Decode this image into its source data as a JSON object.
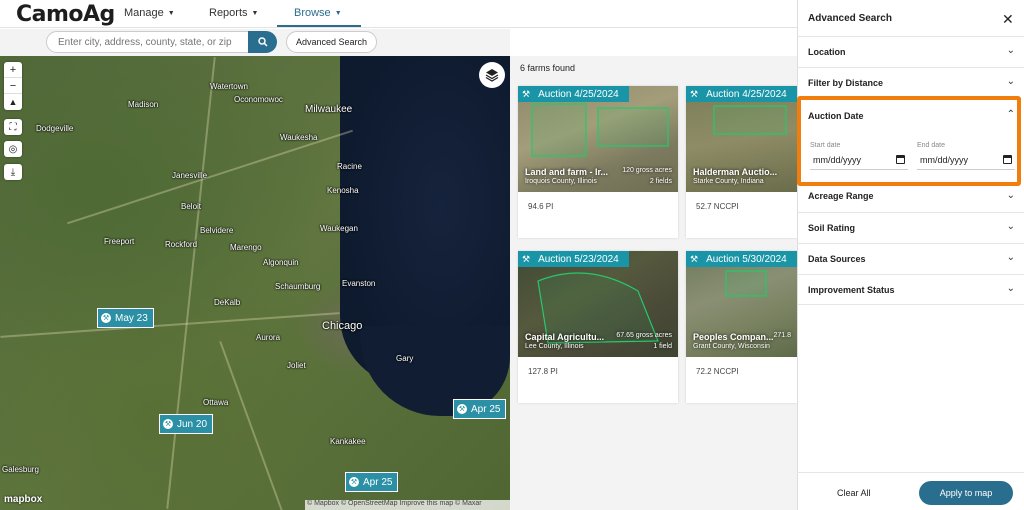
{
  "header": {
    "logo": "CamoAg",
    "nav": [
      {
        "label": "Manage"
      },
      {
        "label": "Reports"
      },
      {
        "label": "Browse"
      }
    ]
  },
  "search": {
    "placeholder": "Enter city, address, county, state, or zip",
    "advanced_label": "Advanced Search"
  },
  "map": {
    "cities": [
      "Madison",
      "Milwaukee",
      "Waukesha",
      "Janesville",
      "Racine",
      "Kenosha",
      "Beloit",
      "Waukegan",
      "Freeport",
      "Rockford",
      "Marengo",
      "Algonquin",
      "Evanston",
      "Schaumburg",
      "DeKalb",
      "Chicago",
      "Joliet",
      "Gary",
      "Ottawa",
      "Kankakee",
      "Galesburg",
      "Oconomowoc",
      "Watertown",
      "Dodgeville",
      "Belvidere",
      "Aurora"
    ],
    "markers": [
      {
        "label": "May 23"
      },
      {
        "label": "Jun 20"
      },
      {
        "label": "Apr 25"
      },
      {
        "label": "Apr 25"
      }
    ],
    "mapbox_label": "mapbox",
    "attribution": "© Mapbox © OpenStreetMap Improve this map © Maxar"
  },
  "results": {
    "count_label": "6 farms found",
    "cards": [
      {
        "banner": "Auction 4/25/2024",
        "title": "Land and farm - Ir...",
        "acres": "120 gross acres",
        "location": "Iroquois County, Illinois",
        "fields": "2 fields",
        "metric": "94.6 PI"
      },
      {
        "banner": "Auction 4/25/2024",
        "title": "Halderman Auctio...",
        "acres": "",
        "location": "Starke County, Indiana",
        "fields": "",
        "metric": "52.7 NCCPI"
      },
      {
        "banner": "Auction 5/23/2024",
        "title": "Capital Agricultu...",
        "acres": "67.65 gross acres",
        "location": "Lee County, Illinois",
        "fields": "1 field",
        "metric": "127.8 PI"
      },
      {
        "banner": "Auction 5/30/2024",
        "title": "Peoples Compan...",
        "acres": "271.8",
        "location": "Grant County, Wisconsin",
        "fields": "",
        "metric": "72.2 NCCPI"
      }
    ]
  },
  "panel": {
    "title": "Advanced Search",
    "sections": [
      {
        "label": "Location"
      },
      {
        "label": "Filter by Distance"
      },
      {
        "label": "Auction Date"
      },
      {
        "label": "Acreage Range"
      },
      {
        "label": "Soil Rating"
      },
      {
        "label": "Data Sources"
      },
      {
        "label": "Improvement Status"
      }
    ],
    "start_date_label": "Start date",
    "end_date_label": "End date",
    "date_placeholder": "mm/dd/yyyy",
    "clear_label": "Clear All",
    "apply_label": "Apply to map",
    "highlight_color": "#f07d0c",
    "accent_color": "#2a6e8f"
  }
}
